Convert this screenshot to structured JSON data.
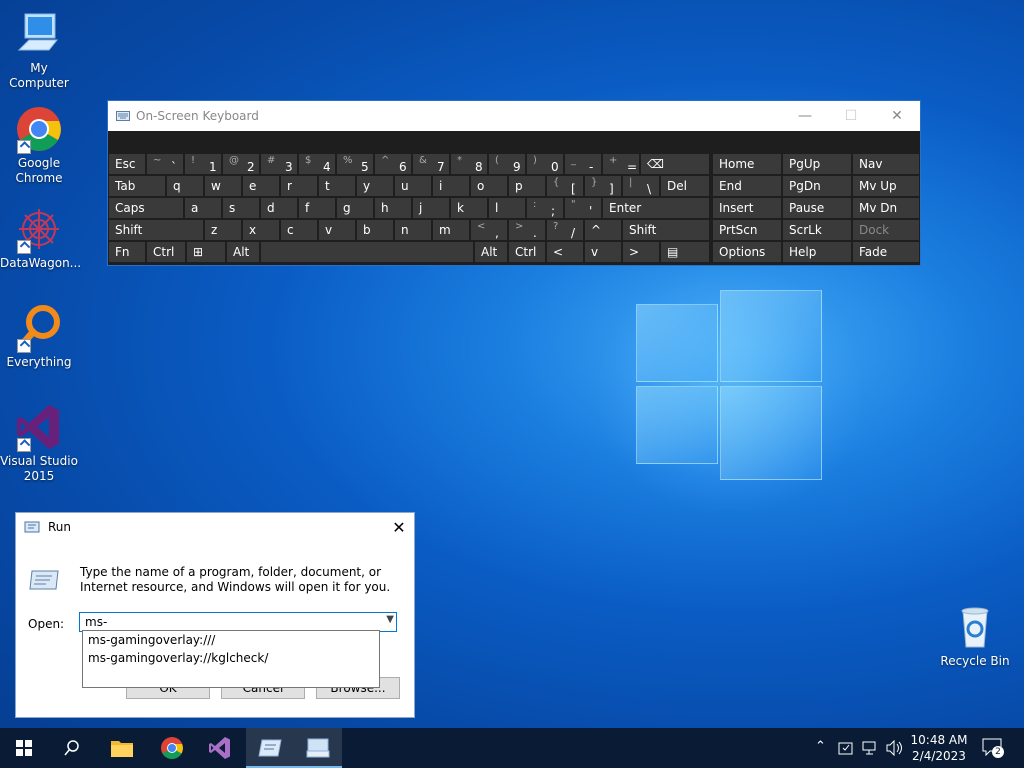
{
  "desktop": {
    "icons": [
      {
        "label": "My Computer"
      },
      {
        "label": "Google\nChrome"
      },
      {
        "label": "DataWagon..."
      },
      {
        "label": "Everything"
      },
      {
        "label": "Visual Studio\n2015"
      },
      {
        "label": "Recycle Bin"
      }
    ]
  },
  "osk": {
    "title": "On-Screen Keyboard",
    "controls": [
      "—",
      "☐",
      "✕"
    ],
    "rows": [
      [
        {
          "l": "Esc"
        },
        {
          "s": "~",
          "m": "`"
        },
        {
          "s": "!",
          "m": "1"
        },
        {
          "s": "@",
          "m": "2"
        },
        {
          "s": "#",
          "m": "3"
        },
        {
          "s": "$",
          "m": "4"
        },
        {
          "s": "%",
          "m": "5"
        },
        {
          "s": "^",
          "m": "6"
        },
        {
          "s": "&",
          "m": "7"
        },
        {
          "s": "*",
          "m": "8"
        },
        {
          "s": "(",
          "m": "9"
        },
        {
          "s": ")",
          "m": "0"
        },
        {
          "s": "_",
          "m": "-"
        },
        {
          "s": "+",
          "m": "="
        },
        {
          "l": "⌫"
        }
      ],
      [
        {
          "l": "Tab"
        },
        {
          "l": "q"
        },
        {
          "l": "w"
        },
        {
          "l": "e"
        },
        {
          "l": "r"
        },
        {
          "l": "t"
        },
        {
          "l": "y"
        },
        {
          "l": "u"
        },
        {
          "l": "i"
        },
        {
          "l": "o"
        },
        {
          "l": "p"
        },
        {
          "s": "{",
          "m": "["
        },
        {
          "s": "}",
          "m": "]"
        },
        {
          "s": "|",
          "m": "\\"
        },
        {
          "l": "Del"
        }
      ],
      [
        {
          "l": "Caps"
        },
        {
          "l": "a"
        },
        {
          "l": "s"
        },
        {
          "l": "d"
        },
        {
          "l": "f"
        },
        {
          "l": "g"
        },
        {
          "l": "h"
        },
        {
          "l": "j"
        },
        {
          "l": "k"
        },
        {
          "l": "l"
        },
        {
          "s": ":",
          "m": ";"
        },
        {
          "s": "\"",
          "m": "'"
        },
        {
          "l": "Enter"
        }
      ],
      [
        {
          "l": "Shift"
        },
        {
          "l": "z"
        },
        {
          "l": "x"
        },
        {
          "l": "c"
        },
        {
          "l": "v"
        },
        {
          "l": "b"
        },
        {
          "l": "n"
        },
        {
          "l": "m"
        },
        {
          "s": "<",
          "m": ","
        },
        {
          "s": ">",
          "m": "."
        },
        {
          "s": "?",
          "m": "/"
        },
        {
          "l": "^"
        },
        {
          "l": "Shift"
        }
      ],
      [
        {
          "l": "Fn"
        },
        {
          "l": "Ctrl"
        },
        {
          "l": "⊞"
        },
        {
          "l": "Alt"
        },
        {
          "l": ""
        },
        {
          "l": "Alt"
        },
        {
          "l": "Ctrl"
        },
        {
          "l": "<"
        },
        {
          "l": "v"
        },
        {
          "l": ">"
        },
        {
          "l": "▤"
        }
      ]
    ],
    "nav": [
      [
        "Home",
        "PgUp",
        "Nav"
      ],
      [
        "End",
        "PgDn",
        "Mv Up"
      ],
      [
        "Insert",
        "Pause",
        "Mv Dn"
      ],
      [
        "PrtScn",
        "ScrLk",
        "Dock"
      ],
      [
        "Options",
        "Help",
        "Fade"
      ]
    ]
  },
  "run": {
    "title": "Run",
    "description": "Type the name of a program, folder, document, or Internet resource, and Windows will open it for you.",
    "open_label": "Open:",
    "input_value": "ms-",
    "suggestions": [
      "ms-gamingoverlay:///",
      "ms-gamingoverlay://kglcheck/"
    ],
    "ok": "OK",
    "cancel": "Cancel",
    "browse": "Browse..."
  },
  "taskbar": {
    "time": "10:48 AM",
    "date": "2/4/2023",
    "notifications": "2"
  }
}
